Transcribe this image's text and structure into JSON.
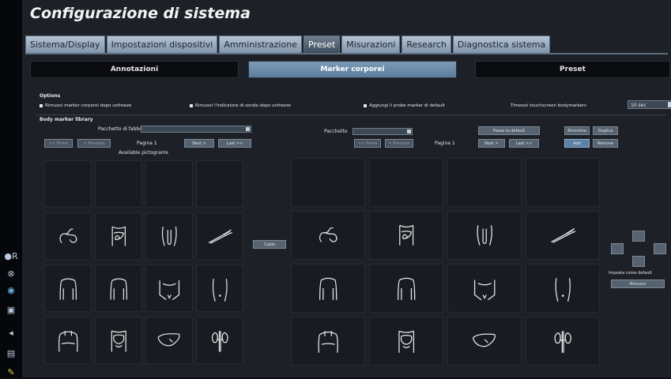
{
  "window": {
    "title": "Configurazione di sistema"
  },
  "tabs": [
    "Sistema/Display",
    "Impostazioni dispositivi",
    "Amministrazione",
    "Preset",
    "Misurazioni",
    "Research",
    "Diagnostica sistema"
  ],
  "subtabs": [
    "Annotazioni",
    "Marker corporei",
    "Preset"
  ],
  "options": {
    "section_label": "Options",
    "items": [
      "Rimuovi marker corporei dopo unfreeze",
      "Rimuovi l'indicatore di sonda dopo unfreeze",
      "Aggiungi il probe marker di default"
    ],
    "timeout_label": "Timeout touchscreen bodymarkers",
    "timeout_value": "10 sec"
  },
  "library": {
    "section_label": "Body marker library",
    "left": {
      "package_label": "Pacchetto di fabbrica",
      "page_label": "Pagina 1",
      "available_label": "Available pictograms",
      "btn_first": "<< Prima",
      "btn_prev": "< Previous",
      "btn_next": "Next >",
      "btn_last": "Last >>"
    },
    "right": {
      "package_label": "Pacchetto",
      "page_label": "Pagina 1",
      "btn_first": "<< Prima",
      "btn_prev": "< Previous",
      "btn_next": "Next >",
      "btn_last": "Last >>",
      "btn_set_default": "Passa to default",
      "btn_rename": "Rinomina",
      "btn_duplicate": "Duplica",
      "btn_add": "Add",
      "btn_remove": "Remove"
    },
    "copy_button": "Copia",
    "side": {
      "default_btn": "Imposta come default",
      "remove_btn": "Rimuovi"
    }
  },
  "left_icons": [
    "colon",
    "abdomen",
    "pelvis",
    "vessel",
    "torso",
    "torso",
    "pelvis-front",
    "hips",
    "chest-front",
    "abdomen-organs",
    "liver",
    "kidneys"
  ],
  "right_icons": [
    "colon",
    "abdomen",
    "pelvis",
    "vessel",
    "torso",
    "torso",
    "pelvis-front",
    "hips",
    "chest-front",
    "abdomen-organs",
    "liver",
    "kidneys"
  ]
}
